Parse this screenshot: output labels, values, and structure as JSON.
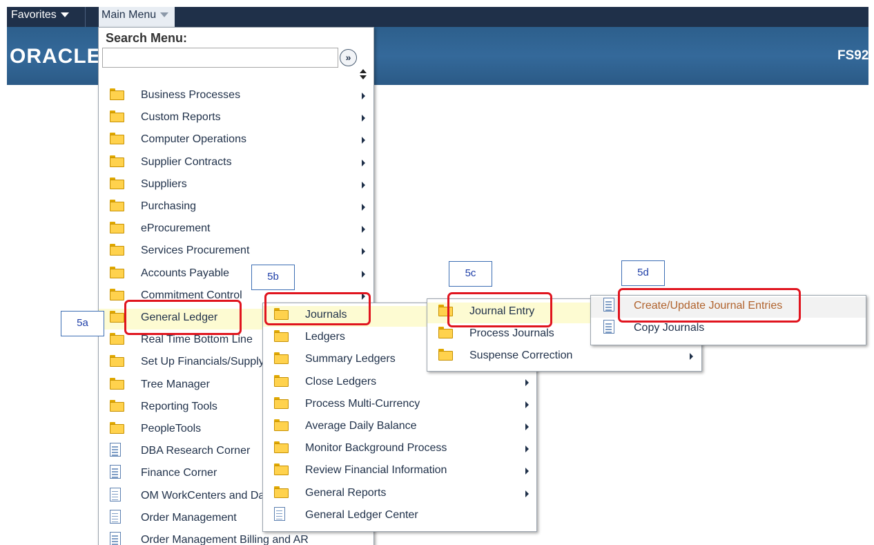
{
  "topbar": {
    "favorites_label": "Favorites",
    "main_menu_label": "Main Menu",
    "logo_text": "ORACLE",
    "system_label": "FS92"
  },
  "search": {
    "title": "Search Menu:",
    "value": "",
    "go_glyph": "»"
  },
  "main_menu": {
    "items": [
      {
        "label": "Business Processes",
        "icon": "folder-icon",
        "has_submenu": true
      },
      {
        "label": "Custom Reports",
        "icon": "folder-icon",
        "has_submenu": true
      },
      {
        "label": "Computer Operations",
        "icon": "folder-icon",
        "has_submenu": true
      },
      {
        "label": "Supplier Contracts",
        "icon": "folder-icon",
        "has_submenu": true
      },
      {
        "label": "Suppliers",
        "icon": "folder-icon",
        "has_submenu": true
      },
      {
        "label": "Purchasing",
        "icon": "folder-icon",
        "has_submenu": true
      },
      {
        "label": "eProcurement",
        "icon": "folder-icon",
        "has_submenu": true
      },
      {
        "label": "Services Procurement",
        "icon": "folder-icon",
        "has_submenu": true
      },
      {
        "label": "Accounts Payable",
        "icon": "folder-icon",
        "has_submenu": true
      },
      {
        "label": "Commitment Control",
        "icon": "folder-icon",
        "has_submenu": true
      },
      {
        "label": "General Ledger",
        "icon": "folder-icon",
        "has_submenu": true,
        "highlighted": true
      },
      {
        "label": "Real Time Bottom Line",
        "icon": "folder-icon",
        "has_submenu": true
      },
      {
        "label": "Set Up Financials/Supply Chain",
        "icon": "folder-icon",
        "has_submenu": true
      },
      {
        "label": "Tree Manager",
        "icon": "folder-icon",
        "has_submenu": true
      },
      {
        "label": "Reporting Tools",
        "icon": "folder-icon",
        "has_submenu": true
      },
      {
        "label": "PeopleTools",
        "icon": "folder-icon",
        "has_submenu": true
      },
      {
        "label": "DBA Research Corner",
        "icon": "document-icon",
        "has_submenu": false
      },
      {
        "label": "Finance Corner",
        "icon": "document-icon",
        "has_submenu": false
      },
      {
        "label": "OM WorkCenters and Dashboards",
        "icon": "document-icon",
        "has_submenu": false
      },
      {
        "label": "Order Management",
        "icon": "document-icon",
        "has_submenu": false
      },
      {
        "label": "Order Management Billing and AR",
        "icon": "document-icon",
        "has_submenu": false
      }
    ]
  },
  "general_ledger_menu": {
    "items": [
      {
        "label": "Journals",
        "icon": "folder-icon",
        "has_submenu": true,
        "highlighted": true
      },
      {
        "label": "Ledgers",
        "icon": "folder-icon",
        "has_submenu": true
      },
      {
        "label": "Summary Ledgers",
        "icon": "folder-icon",
        "has_submenu": true
      },
      {
        "label": "Close Ledgers",
        "icon": "folder-icon",
        "has_submenu": true
      },
      {
        "label": "Process Multi-Currency",
        "icon": "folder-icon",
        "has_submenu": true
      },
      {
        "label": "Average Daily Balance",
        "icon": "folder-icon",
        "has_submenu": true
      },
      {
        "label": "Monitor Background Process",
        "icon": "folder-icon",
        "has_submenu": true
      },
      {
        "label": "Review Financial Information",
        "icon": "folder-icon",
        "has_submenu": true
      },
      {
        "label": "General Reports",
        "icon": "folder-icon",
        "has_submenu": true
      },
      {
        "label": "General Ledger Center",
        "icon": "document-icon",
        "has_submenu": false
      }
    ]
  },
  "journals_menu": {
    "items": [
      {
        "label": "Journal Entry",
        "icon": "folder-icon",
        "has_submenu": true,
        "highlighted": true
      },
      {
        "label": "Process Journals",
        "icon": "folder-icon",
        "has_submenu": true
      },
      {
        "label": "Suspense Correction",
        "icon": "folder-icon",
        "has_submenu": true
      }
    ]
  },
  "journal_entry_menu": {
    "items": [
      {
        "label": "Create/Update Journal Entries",
        "icon": "document-icon",
        "highlighted": true
      },
      {
        "label": "Copy Journals",
        "icon": "document-icon"
      }
    ]
  },
  "callouts": {
    "step_5a": "5a",
    "step_5b": "5b",
    "step_5c": "5c",
    "step_5d": "5d"
  },
  "colors": {
    "top_bar": "#1f3049",
    "banner": "#34699a",
    "highlight_row": "#fdfbd2",
    "annotation_red": "#e0141e",
    "callout_blue": "#3b6db3"
  }
}
